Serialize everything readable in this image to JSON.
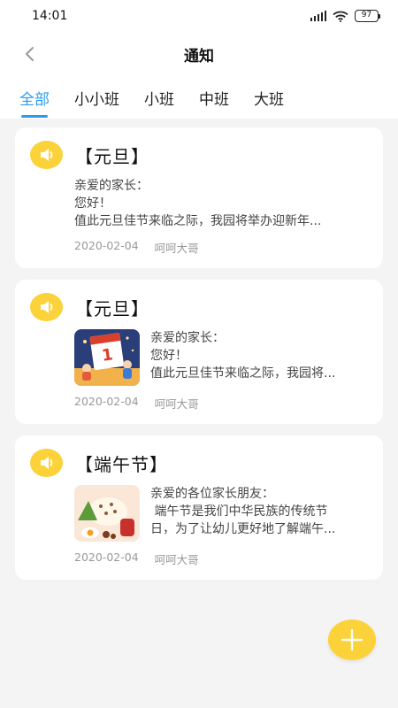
{
  "status": {
    "time": "14:01",
    "battery": "97"
  },
  "header": {
    "title": "通知"
  },
  "tabs": [
    {
      "label": "全部",
      "active": true
    },
    {
      "label": "小小班"
    },
    {
      "label": "小班"
    },
    {
      "label": "中班"
    },
    {
      "label": "大班"
    }
  ],
  "notices": [
    {
      "title": "【元旦】",
      "lines": [
        "亲爱的家长：",
        "您好！",
        "值此元旦佳节来临之际，我园将举办迎新年..."
      ],
      "date": "2020-02-04",
      "author": "呵呵大哥",
      "thumbnail": null
    },
    {
      "title": "【元旦】",
      "lines": [
        "亲爱的家长：",
        "您好！",
        "值此元旦佳节来临之际，我园将..."
      ],
      "date": "2020-02-04",
      "author": "呵呵大哥",
      "thumbnail": "new-year-calendar-illustration"
    },
    {
      "title": "【端午节】",
      "lines": [
        "亲爱的各位家长朋友：",
        " 端午节是我们中华民族的传统节",
        "日，为了让幼儿更好地了解端午..."
      ],
      "date": "2020-02-04",
      "author": "呵呵大哥",
      "thumbnail": "dragon-boat-food-illustration"
    }
  ],
  "colors": {
    "accent": "#2a9cf0",
    "badge": "#fcd23b",
    "background": "#f4f4f4"
  }
}
